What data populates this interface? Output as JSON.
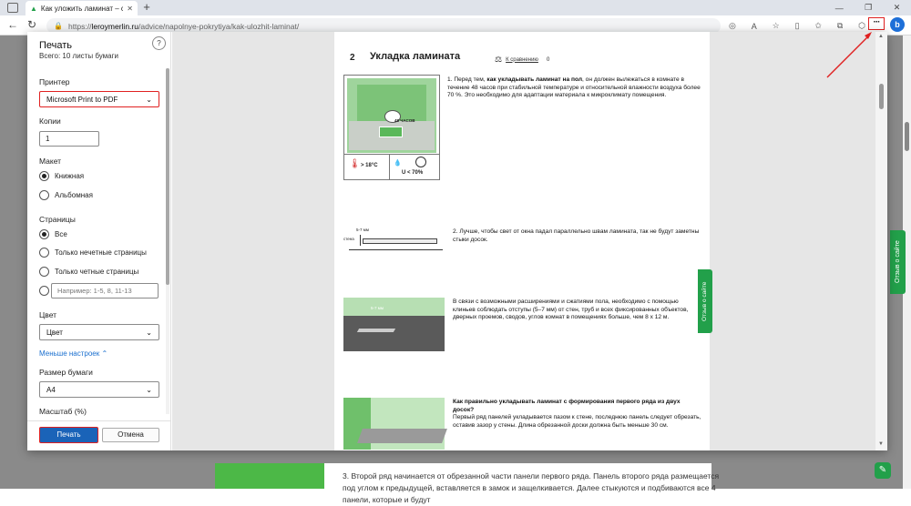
{
  "browser": {
    "tab_title": "Как уложить ламинат – советы",
    "url_domain": "leroymerlin.ru",
    "url_prefix": "https://",
    "url_path": "/advice/napolnye-pokrytiya/kak-ulozhit-laminat/",
    "menu_label": "···",
    "bing_label": "b"
  },
  "print_dialog": {
    "title": "Печать",
    "subtitle": "Всего: 10 листы бумаги",
    "help": "?",
    "printer_label": "Принтер",
    "printer_value": "Microsoft Print to PDF",
    "copies_label": "Копии",
    "copies_value": "1",
    "layout_label": "Макет",
    "layout_options": [
      "Книжная",
      "Альбомная"
    ],
    "layout_selected": 0,
    "pages_label": "Страницы",
    "pages_options": [
      "Все",
      "Только нечетные страницы",
      "Только четные страницы"
    ],
    "pages_custom_placeholder": "Например: 1-5, 8, 11-13",
    "color_label": "Цвет",
    "color_value": "Цвет",
    "fewer_settings": "Меньше настроек",
    "paper_label": "Размер бумаги",
    "paper_value": "A4",
    "scale_label": "Масштаб (%)",
    "print_button": "Печать",
    "cancel_button": "Отмена"
  },
  "preview": {
    "section_number": "2",
    "section_title": "Укладка ламината",
    "compare_label": "К сравнению",
    "compare_count": "0",
    "feedback_tab": "Отзыв о сайте",
    "img1_label_hours": "48 ЧАСОВ",
    "img1_temp": "> 18°C",
    "img1_humidity": "U < 70%",
    "img2_label_gap": "5-7 мм",
    "img2_label_wall": "стена",
    "img3_label_gap": "5-7 мм",
    "step1_prefix": "1. Перед тем, ",
    "step1_bold": "как укладывать ламинат на пол",
    "step1_rest": ", он должен вылежаться в комнате в течение 48 часов при стабильной температуре и относительной влажности воздуха более 70 %. Это необходимо для адаптации материала к микроклимату помещения.",
    "step2": "2. Лучше, чтобы свет от окна падал параллельно швам ламината, так не будут заметны стыки досок.",
    "step3": "В связи с возможными расширениями и сжатиями пола, необходимо с помощью клиньев соблюдать отступы (5–7 мм) от стен, труб и всех фиксированных объектов, дверных проемов, сводов, углов комнат в помещениях больше, чем 8 x 12 м.",
    "step4_heading": "Как правильно укладывать ламинат с формирования первого ряда из двух досок?",
    "step4_text": "Первый ряд панелей укладывается пазом к стене, последнюю панель следует обрезать, оставив зазор у стены. Длина обрезанной доски должна быть меньше 30 см."
  },
  "page_behind": {
    "feedback_tab": "Отзыв о сайте",
    "text": "3. Второй ряд начинается от обрезанной части панели первого ряда. Панель второго ряда размещается под углом к предыдущей, вставляется в замок и защелкивается. Далее стыкуются и подбиваются все 4 панели, которые и будут"
  },
  "colors": {
    "accent": "#1a63b8",
    "highlight": "#e02020",
    "brand_green": "#22a04a"
  }
}
